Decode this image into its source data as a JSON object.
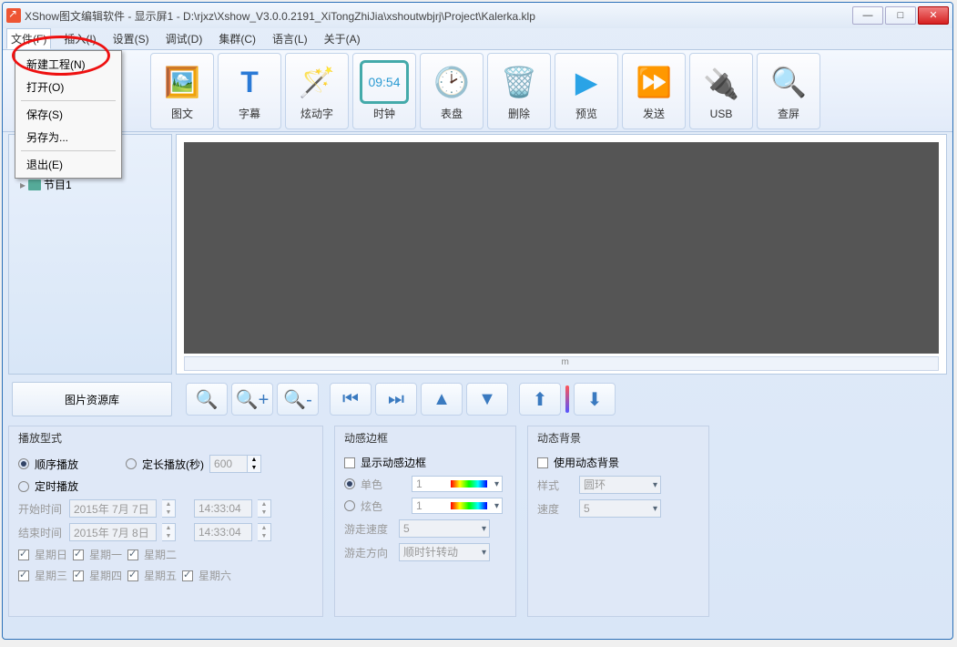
{
  "title": "XShow图文编辑软件 - 显示屏1 - D:\\rjxz\\Xshow_V3.0.0.2191_XiTongZhiJia\\xshoutwbjrj\\Project\\Kalerka.klp",
  "menubar": {
    "file": "文件(F)",
    "insert": "插入(I)",
    "settings": "设置(S)",
    "debug": "调试(D)",
    "cluster": "集群(C)",
    "language": "语言(L)",
    "about": "关于(A)"
  },
  "file_menu": {
    "new": "新建工程(N)",
    "open": "打开(O)",
    "save": "保存(S)",
    "saveas": "另存为...",
    "exit": "退出(E)"
  },
  "toolbar": {
    "image_text": "图文",
    "subtitle": "字幕",
    "anim_text": "炫动字",
    "clock": "时钟",
    "dial": "表盘",
    "delete": "删除",
    "preview": "预览",
    "send": "发送",
    "usb": "USB",
    "find": "查屏"
  },
  "clock_digits": "09:54",
  "tree": {
    "node0": "节目1"
  },
  "lib_btn": "图片资源库",
  "play_group": {
    "legend": "播放型式",
    "order": "顺序播放",
    "fixed": "定长播放(秒)",
    "fixed_val": "600",
    "timed": "定时播放",
    "start_label": "开始时间",
    "start_date": "2015年 7月 7日",
    "start_time": "14:33:04",
    "end_label": "结束时间",
    "end_date": "2015年 7月 8日",
    "end_time": "14:33:04",
    "sun": "星期日",
    "mon": "星期一",
    "tue": "星期二",
    "wed": "星期三",
    "thu": "星期四",
    "fri": "星期五",
    "sat": "星期六"
  },
  "border_group": {
    "legend": "动感边框",
    "show": "显示动感边框",
    "solid": "单色",
    "solid_val": "1",
    "glow": "炫色",
    "glow_val": "1",
    "speed_label": "游走速度",
    "speed": "5",
    "dir_label": "游走方向",
    "dir": "顺时针转动"
  },
  "bg_group": {
    "legend": "动态背景",
    "use": "使用动态背景",
    "style_label": "样式",
    "style": "圆环",
    "speed_label": "速度",
    "speed": "5"
  }
}
